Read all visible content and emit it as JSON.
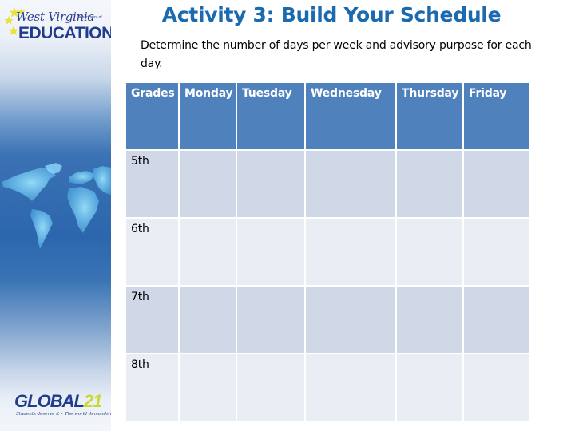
{
  "branding": {
    "top_logo": {
      "script_text": "West Virginia",
      "dept_text": "Department of",
      "main_text": "EDUCATION",
      "star_color": "#e8e23a",
      "text_color": "#1f3c8f"
    },
    "bottom_logo": {
      "word_part1": "GL",
      "globe_letter": "O",
      "word_part2": "BAL",
      "number": "21",
      "tagline": "Students deserve it • The world demands it",
      "word_color": "#1f3c8f",
      "number_color": "#c9d836"
    },
    "side_panel_image": "world-map"
  },
  "slide": {
    "title": "Activity 3: Build Your Schedule",
    "title_color": "#1b6ab0",
    "description": "Determine the number of days per week and advisory purpose for each day."
  },
  "schedule_table": {
    "header_color": "#4f81bd",
    "row_colors": [
      "#d0d8e8",
      "#e9edf4"
    ],
    "columns": [
      "Grades",
      "Monday",
      "Tuesday",
      "Wednesday",
      "Thursday",
      "Friday"
    ],
    "rows": [
      {
        "grade": "5th",
        "cells": [
          "",
          "",
          "",
          "",
          ""
        ]
      },
      {
        "grade": "6th",
        "cells": [
          "",
          "",
          "",
          "",
          ""
        ]
      },
      {
        "grade": "7th",
        "cells": [
          "",
          "",
          "",
          "",
          ""
        ]
      },
      {
        "grade": "8th",
        "cells": [
          "",
          "",
          "",
          "",
          ""
        ]
      }
    ]
  }
}
